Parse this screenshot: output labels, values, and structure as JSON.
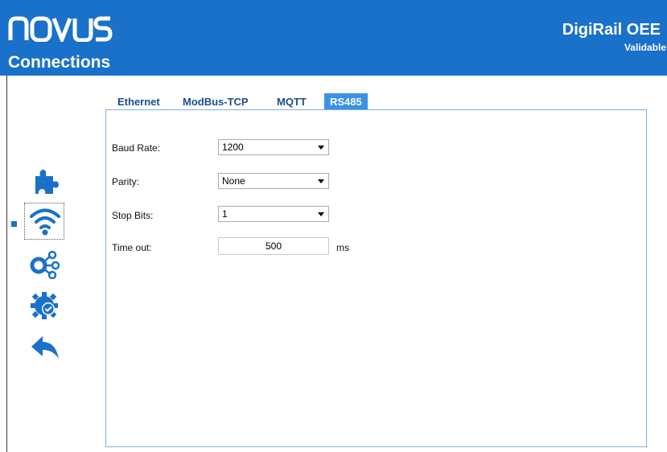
{
  "header": {
    "logo_text": "NOVUS",
    "page_title": "Connections",
    "product_name": "DigiRail OEE",
    "product_subtitle": "Validable",
    "color": "#1a71c9"
  },
  "sidebar": {
    "items": [
      {
        "name": "puzzle-icon",
        "selected": false
      },
      {
        "name": "wifi-icon",
        "selected": true
      },
      {
        "name": "network-nodes-icon",
        "selected": false
      },
      {
        "name": "gear-check-icon",
        "selected": false
      },
      {
        "name": "back-arrow-icon",
        "selected": false
      }
    ]
  },
  "tabs": [
    {
      "label": "Ethernet",
      "active": false
    },
    {
      "label": "ModBus-TCP",
      "active": false
    },
    {
      "label": "MQTT",
      "active": false
    },
    {
      "label": "RS485",
      "active": true
    }
  ],
  "form": {
    "baud_rate": {
      "label": "Baud Rate:",
      "value": "1200"
    },
    "parity": {
      "label": "Parity:",
      "value": "None"
    },
    "stop_bits": {
      "label": "Stop Bits:",
      "value": "1"
    },
    "timeout": {
      "label": "Time out:",
      "value": "500",
      "unit": "ms"
    }
  }
}
